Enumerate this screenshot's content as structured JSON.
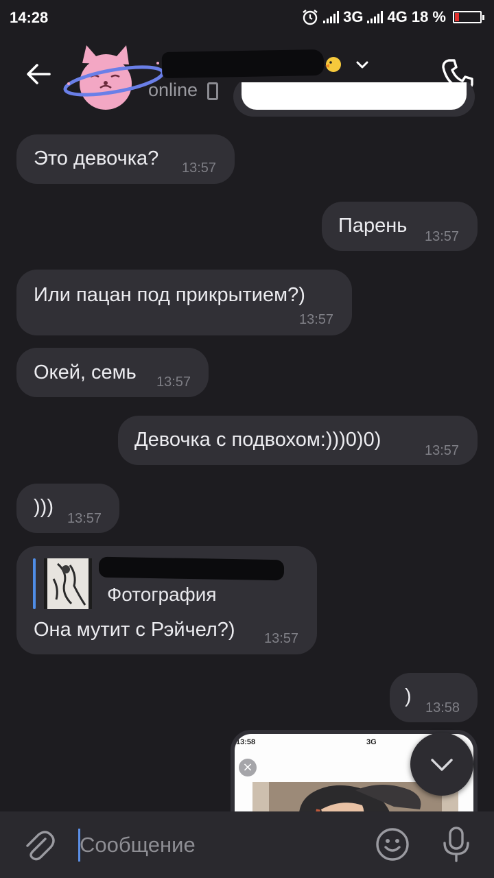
{
  "status_bar": {
    "time": "14:28",
    "network_1": "3G",
    "network_2": "4G",
    "battery": "18 %",
    "battery_level": 0.18
  },
  "header": {
    "status": "online"
  },
  "messages": [
    {
      "text": "Это девочка?",
      "time": "13:57",
      "side": "in"
    },
    {
      "text": "Парень",
      "time": "13:57",
      "side": "out"
    },
    {
      "text": "Или пацан под прикрытием?)",
      "time": "13:57",
      "side": "in"
    },
    {
      "text": "Окей, семь",
      "time": "13:57",
      "side": "in"
    },
    {
      "text": "Девочка с подвохом:)))0)0)",
      "time": "13:57",
      "side": "out"
    },
    {
      "text": ")))",
      "time": "13:57",
      "side": "in"
    },
    {
      "text": "Она мутит с Рэйчел?)",
      "time": "13:57",
      "side": "in",
      "reply_kind": "Фотография"
    },
    {
      "text": ")",
      "time": "13:58",
      "side": "out"
    }
  ],
  "screenshot_preview": {
    "time": "13:58",
    "network": "3G"
  },
  "composer": {
    "placeholder": "Сообщение"
  },
  "colors": {
    "background": "#1d1c20",
    "bubble": "#313036",
    "accent": "#4f8de6",
    "composer": "#2a292e"
  }
}
